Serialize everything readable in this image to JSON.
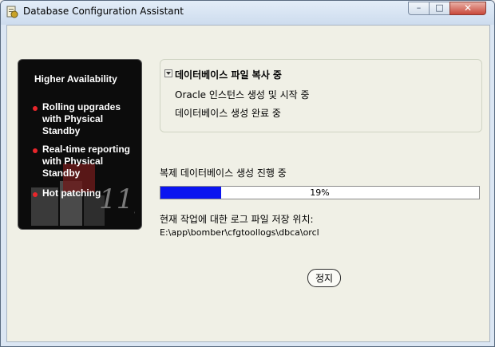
{
  "window": {
    "title": "Database Configuration Assistant",
    "controls": {
      "minimize": "–",
      "maximize": "□",
      "close": "✕"
    }
  },
  "sidebar": {
    "heading": "Higher Availability",
    "items": [
      {
        "line1": "Rolling upgrades",
        "line2": "with Physical",
        "line3": "Standby"
      },
      {
        "line1": "Real-time reporting",
        "line2": "with Physical",
        "line3": "Standby"
      },
      {
        "line1": "Hot patching",
        "line2": "",
        "line3": ""
      }
    ],
    "logo_text": "11g",
    "accent_color": "#e8262b"
  },
  "steps": [
    {
      "label": "데이터베이스 파일 복사 중",
      "current": true
    },
    {
      "label": "Oracle 인스턴스 생성 및 시작 중",
      "current": false
    },
    {
      "label": "데이터베이스 생성 완료 중",
      "current": false
    }
  ],
  "progress": {
    "label": "복제 데이터베이스 생성 진행 중",
    "percent_text": "19%",
    "fraction": 0.19,
    "color": "#0a14f0"
  },
  "log": {
    "label": "현재 작업에 대한 로그 파일 저장 위치:",
    "path": "E:\\app\\bomber\\cfgtoollogs\\dbca\\orcl"
  },
  "buttons": {
    "stop": "정지"
  }
}
